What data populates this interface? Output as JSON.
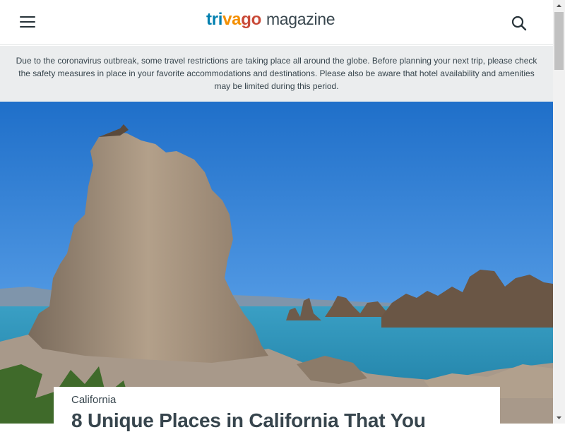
{
  "header": {
    "logo": {
      "part1": "tri",
      "part2": "va",
      "part3": "go",
      "suffix": "magazine"
    },
    "menu_icon": "hamburger-menu-icon",
    "search_icon": "search-icon"
  },
  "notice": {
    "text": "Due to the coronavirus outbreak, some travel restrictions are taking place all around the globe. Before planning your next trip, please check the safety measures in place in your favorite accommodations and destinations. Please also be aware that hotel availability and amenities may be limited during this period."
  },
  "article": {
    "category": "California",
    "title": "8 Unique Places in California That You"
  },
  "colors": {
    "brand_blue": "#007faf",
    "brand_orange": "#f48f00",
    "brand_red": "#c94a38",
    "notice_bg": "#ebedee",
    "text": "#37454d"
  }
}
